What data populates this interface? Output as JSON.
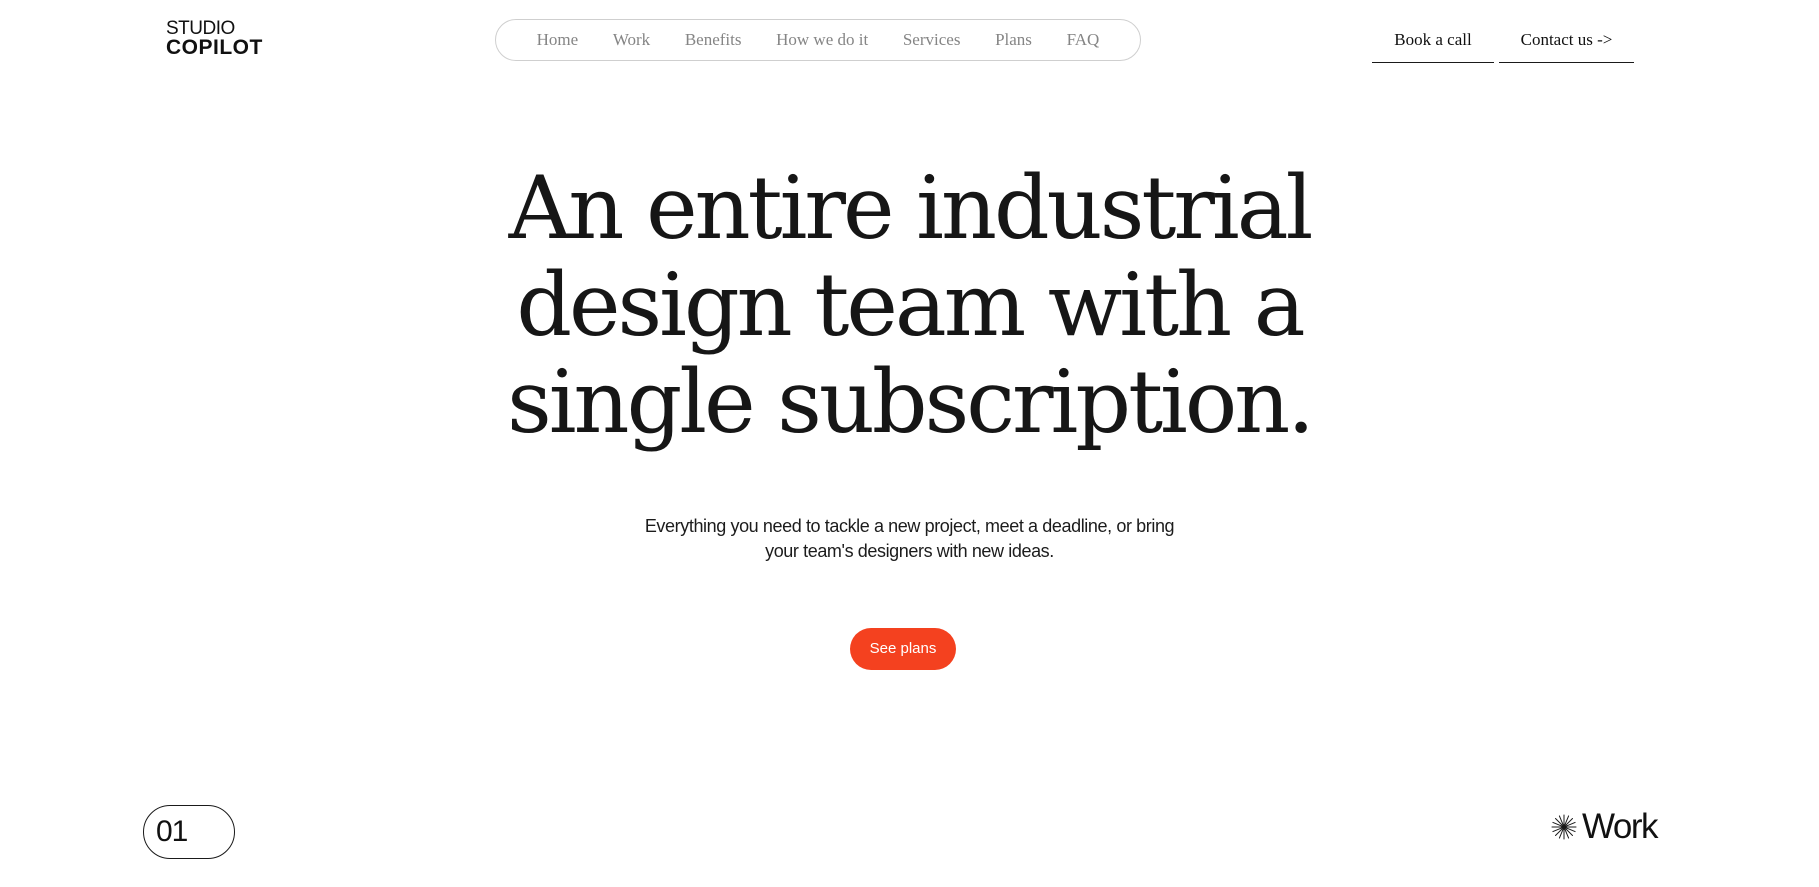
{
  "logo": {
    "line1": "STUDIO",
    "line2": "COPILOT"
  },
  "nav": {
    "items": [
      {
        "label": "Home"
      },
      {
        "label": "Work"
      },
      {
        "label": "Benefits"
      },
      {
        "label": "How we do it"
      },
      {
        "label": "Services"
      },
      {
        "label": "Plans"
      },
      {
        "label": "FAQ"
      }
    ]
  },
  "actions": {
    "book_label": "Book a call",
    "contact_label": "Contact us ->"
  },
  "hero": {
    "title_lines": [
      "An entire industrial",
      "design team with a",
      "single subscription."
    ],
    "subtitle_lines": [
      "Everything you need to tackle a new project, meet a deadline, or bring",
      "your team's designers with new ideas."
    ],
    "cta_label": "See plans"
  },
  "section": {
    "number": "01",
    "label": "Work",
    "icon": "asterisk-icon"
  },
  "colors": {
    "accent": "#f4411f",
    "text": "#161616",
    "nav_text": "#858585",
    "nav_border": "#cfcfcf",
    "background": "#ffffff"
  }
}
